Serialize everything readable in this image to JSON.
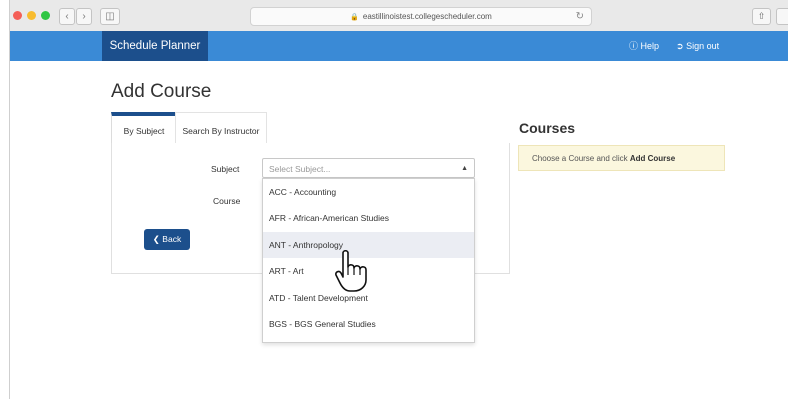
{
  "browser": {
    "url": "eastillinoistest.collegescheduler.com",
    "traffic_colors": [
      "#f45f57",
      "#f8bc2f",
      "#2fc643"
    ]
  },
  "header": {
    "brand": "Schedule Planner",
    "help": "Help",
    "signout": "Sign out",
    "bar_color": "#3a8ad6",
    "brand_color": "#1c4f8c"
  },
  "main": {
    "title": "Add Course",
    "tabs": [
      {
        "label": "By Subject"
      },
      {
        "label": "Search By Instructor"
      }
    ],
    "subject_label": "Subject",
    "course_label": "Course",
    "subject_placeholder": "Select Subject...",
    "subject_options": [
      "ACC - Accounting",
      "AFR - African-American Studies",
      "ANT - Anthropology",
      "ART - Art",
      "ATD - Talent Development",
      "BGS - BGS General Studies"
    ],
    "back_button": "Back"
  },
  "courses": {
    "title": "Courses",
    "notice_prefix": "Choose a Course and click",
    "notice_action": "Add Course"
  }
}
